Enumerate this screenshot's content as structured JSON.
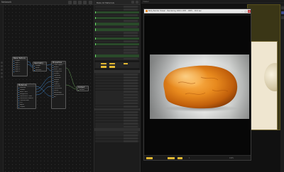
{
  "node_editor": {
    "header_label": "Network",
    "nodes": [
      {
        "title": "Bake Texture",
        "ports": [
          "Output",
          "Input 1",
          "Input 2",
          "Input 3",
          "Input 4",
          "Input 5"
        ]
      },
      {
        "title": "Geometry",
        "ports": [
          "Output",
          "Mesh",
          "Normals"
        ]
      },
      {
        "title": "Properties",
        "ports": [
          "Color Space",
          "Amber",
          "Base Color",
          "Roughness",
          "Metallic",
          "Specular",
          "Clearcoat",
          "Normal",
          "Height",
          "Opacity",
          "Emission",
          "Subsurface",
          "Sheen",
          "Anisotropy",
          "Displacement",
          "AO"
        ]
      },
      {
        "title": "Materials",
        "ports": [
          "Material",
          "Shader",
          "Base Color",
          "Roughness",
          "Subsurface Color",
          "Subsurface Radius",
          "Transmission",
          "IOR",
          "Alpha",
          "Output"
        ]
      },
      {
        "title": "Output",
        "ports": [
          "Render"
        ]
      }
    ]
  },
  "params_panel": {
    "title": "Bake All Materials",
    "yellow_fields": [
      "8",
      "8",
      "4",
      "4",
      "4"
    ]
  },
  "viewer": {
    "header_label": "Viewer",
    "window_title": "Ruby Render Viewer - Rendering 1024 x 683 - 100% - 16.0 sec"
  },
  "status_bar": {
    "frame_label": "1",
    "zoom_label": "100%"
  },
  "colors": {
    "accent_green": "#72e46e",
    "accent_yellow": "#e2b832",
    "wire_blue": "#4aa5ff",
    "amber": "#d3760f"
  }
}
